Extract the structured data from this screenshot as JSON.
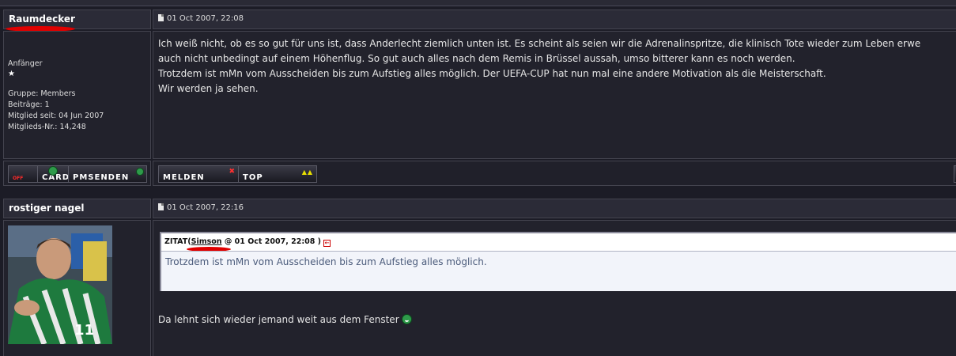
{
  "posts": [
    {
      "author": "Raumdecker",
      "date": "01 Oct 2007, 22:08",
      "rank": "Anfänger",
      "rank_star": "★",
      "group": "Gruppe: Members",
      "posts_count": "Beiträge: 1",
      "member_since": "Mitglied seit: 04 Jun 2007",
      "member_no": "Mitglieds-Nr.: 14,248",
      "body_lines": [
        "Ich weiß nicht, ob es so gut für uns ist, dass Anderlecht ziemlich unten ist. Es scheint als seien wir die Adrenalinspritze, die klinisch Tote wieder zum Leben erwe",
        "auch nicht unbedingt auf einem Höhenflug. So gut auch alles nach dem Remis in Brüssel aussah, umso bitterer kann es noch werden.",
        "Trotzdem ist mMn vom Ausscheiden bis zum Aufstieg alles möglich. Der UEFA-CUP hat nun mal eine andere Motivation als die Meisterschaft.",
        "Wir werden ja sehen."
      ],
      "buttons": {
        "off": "OFF",
        "card": "CARD",
        "pm": "PMSENDEN",
        "report": "MELDEN",
        "top": "TOP"
      }
    },
    {
      "author": "rostiger nagel",
      "date": "01 Oct 2007, 22:16",
      "quote_prefix": "ZITAT(",
      "quote_author": "Simson",
      "quote_suffix": " @ 01 Oct 2007, 22:08 )",
      "quote_text": "Trotzdem ist mMn vom Ausscheiden bis zum Aufstieg alles möglich.",
      "reply": "Da lehnt sich wieder jemand weit aus dem Fenster"
    }
  ],
  "icons": {
    "post_date": "document-icon",
    "quote_back": "quote-link-icon",
    "smiley": "green-smiley-icon"
  },
  "colors": {
    "page_bg": "#1c1c26",
    "cell_bg": "#262631",
    "border": "#44444f",
    "scribble": "#e00000",
    "quote_bg": "#f2f4fa"
  }
}
